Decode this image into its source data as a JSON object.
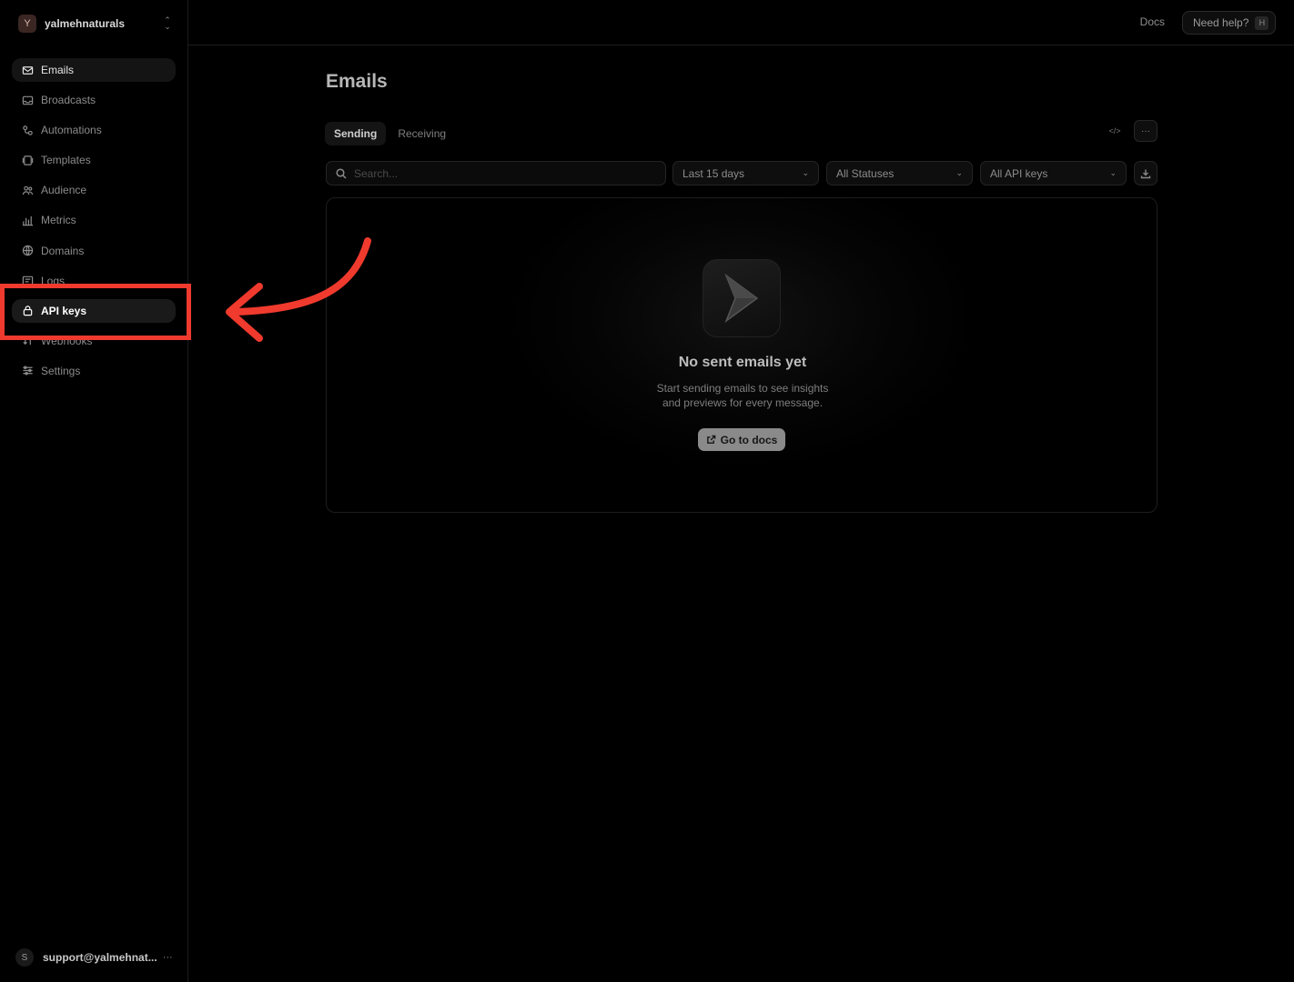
{
  "workspace": {
    "initial": "Y",
    "name": "yalmehnaturals"
  },
  "sidebar": {
    "items": [
      {
        "label": "Emails",
        "icon": "mail-icon"
      },
      {
        "label": "Broadcasts",
        "icon": "inbox-icon"
      },
      {
        "label": "Automations",
        "icon": "automation-icon"
      },
      {
        "label": "Templates",
        "icon": "template-icon"
      },
      {
        "label": "Audience",
        "icon": "users-icon"
      },
      {
        "label": "Metrics",
        "icon": "bar-chart-icon"
      },
      {
        "label": "Domains",
        "icon": "globe-icon"
      },
      {
        "label": "Logs",
        "icon": "logs-icon"
      },
      {
        "label": "API keys",
        "icon": "lock-icon"
      },
      {
        "label": "Webhooks",
        "icon": "webhook-icon"
      },
      {
        "label": "Settings",
        "icon": "sliders-icon"
      }
    ],
    "active_item": "Emails",
    "highlighted_item": "API keys"
  },
  "account": {
    "initial": "S",
    "email": "support@yalmehnat...",
    "more": "···"
  },
  "topbar": {
    "docs_label": "Docs",
    "help_label": "Need help?",
    "help_shortcut": "H"
  },
  "main": {
    "title": "Emails",
    "tabs": [
      {
        "label": "Sending"
      },
      {
        "label": "Receiving"
      }
    ],
    "code_label": "</>",
    "more_label": "···",
    "search_placeholder": "Search...",
    "filters": {
      "date": "Last 15 days",
      "status": "All Statuses",
      "api_key": "All API keys"
    },
    "empty": {
      "title": "No sent emails yet",
      "line1": "Start sending emails to see insights",
      "line2": "and previews for every message.",
      "button": "Go to docs"
    }
  },
  "annotation": {
    "color": "#f03a2e"
  }
}
